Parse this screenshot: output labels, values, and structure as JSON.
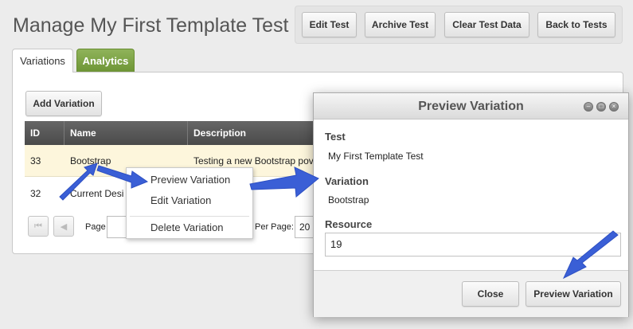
{
  "page": {
    "title": "Manage My First Template Test"
  },
  "header_actions": {
    "edit_test": "Edit Test",
    "archive_test": "Archive Test",
    "clear_test_data": "Clear Test Data",
    "back_to_tests": "Back to Tests"
  },
  "tabs": [
    {
      "label": "Variations",
      "active": true
    },
    {
      "label": "Analytics",
      "active": false
    }
  ],
  "toolbar": {
    "add_variation": "Add Variation"
  },
  "grid": {
    "columns": [
      "ID",
      "Name",
      "Description"
    ],
    "rows": [
      {
        "id": "33",
        "name": "Bootstrap",
        "description": "Testing a new Bootstrap pov"
      },
      {
        "id": "32",
        "name": "Current Desi",
        "description": ""
      }
    ]
  },
  "pager": {
    "page_label": "Page",
    "per_page_label": "Per Page:",
    "per_page_value": "20",
    "first_icon": "first-page-icon",
    "prev_icon": "prev-page-icon"
  },
  "context_menu": {
    "items": [
      "Preview Variation",
      "Edit Variation",
      "Delete Variation"
    ]
  },
  "dialog": {
    "title": "Preview Variation",
    "test_label": "Test",
    "test_value": "My First Template Test",
    "variation_label": "Variation",
    "variation_value": "Bootstrap",
    "resource_label": "Resource",
    "resource_value": "19",
    "close_button": "Close",
    "preview_button": "Preview Variation",
    "controls": [
      "minimize-icon",
      "maximize-icon",
      "close-icon"
    ]
  },
  "colors": {
    "analytics_tab": "#7aa03f",
    "grid_header": "#555555",
    "selected_row": "#fdf6dc",
    "annotation_arrow": "#3a5fd6"
  }
}
